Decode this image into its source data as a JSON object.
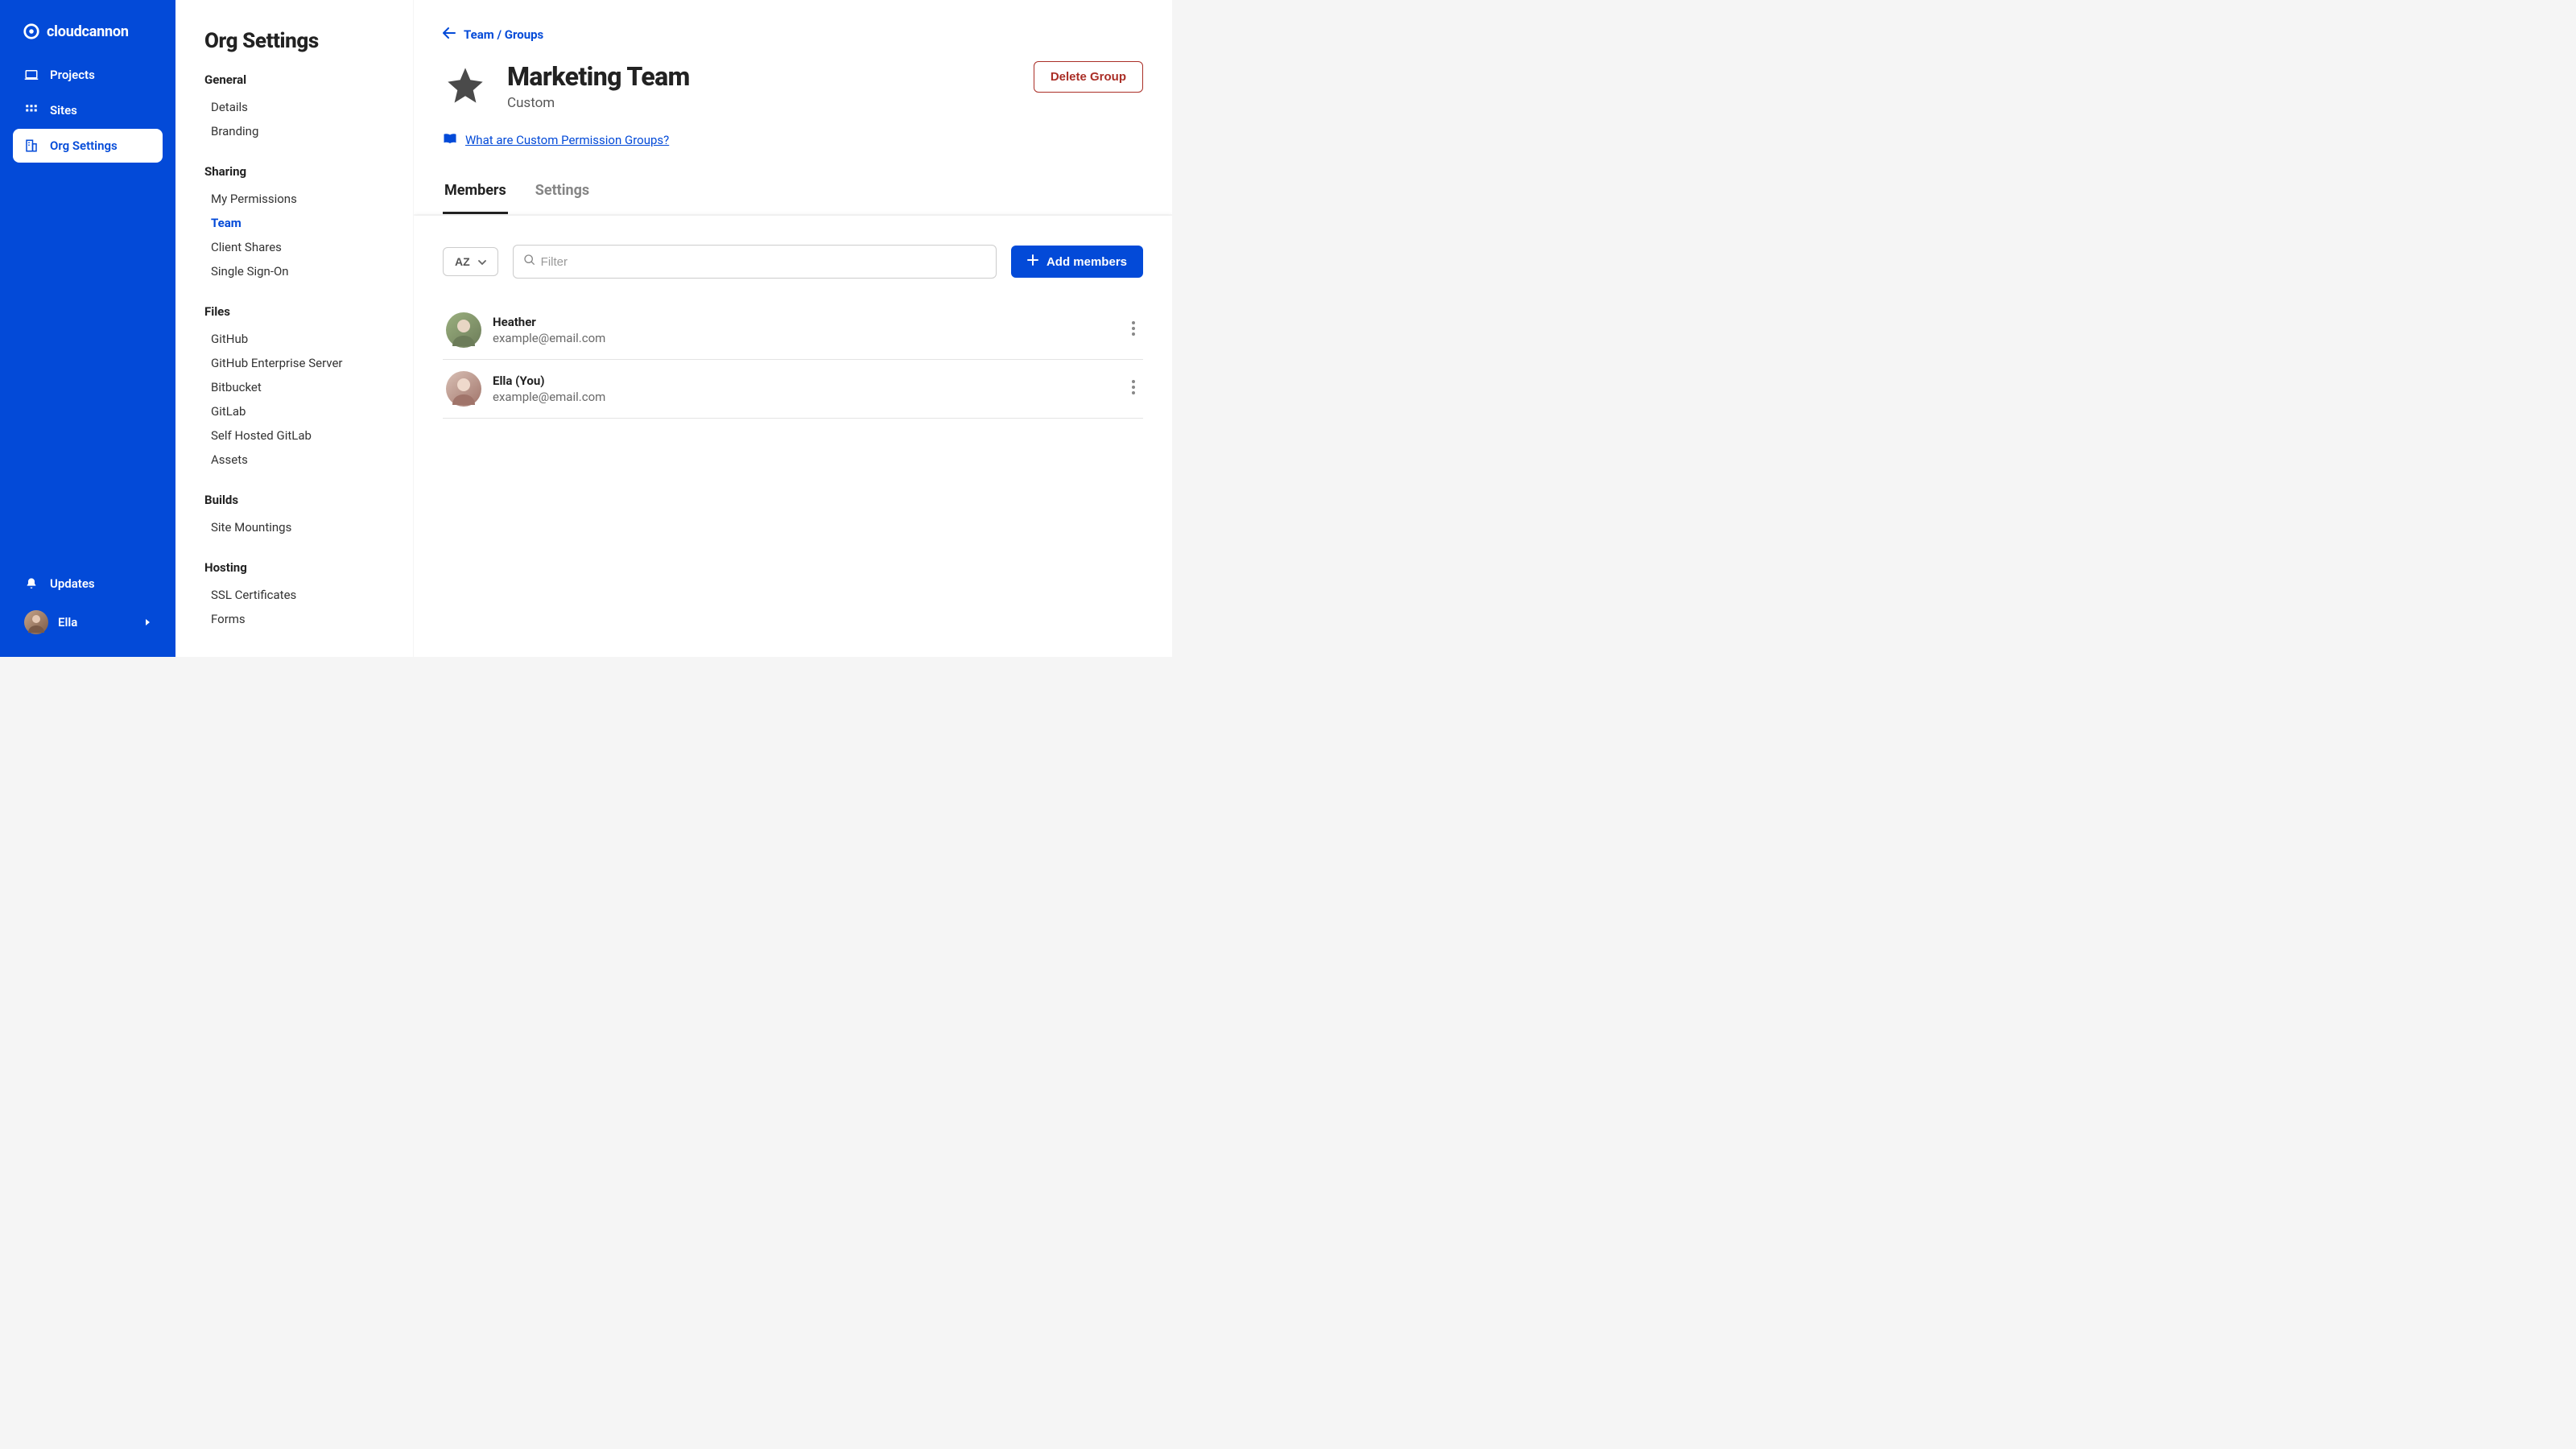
{
  "brand": {
    "name": "cloudcannon"
  },
  "nav": {
    "items": [
      {
        "label": "Projects"
      },
      {
        "label": "Sites"
      },
      {
        "label": "Org Settings"
      }
    ],
    "updates": "Updates",
    "user": "Ella"
  },
  "settings": {
    "title": "Org Settings",
    "groups": [
      {
        "heading": "General",
        "items": [
          "Details",
          "Branding"
        ]
      },
      {
        "heading": "Sharing",
        "items": [
          "My Permissions",
          "Team",
          "Client Shares",
          "Single Sign-On"
        ]
      },
      {
        "heading": "Files",
        "items": [
          "GitHub",
          "GitHub Enterprise Server",
          "Bitbucket",
          "GitLab",
          "Self Hosted GitLab",
          "Assets"
        ]
      },
      {
        "heading": "Builds",
        "items": [
          "Site Mountings"
        ]
      },
      {
        "heading": "Hosting",
        "items": [
          "SSL Certificates",
          "Forms"
        ]
      }
    ]
  },
  "breadcrumb": "Team / Groups",
  "page": {
    "title": "Marketing Team",
    "subtitle": "Custom",
    "delete": "Delete Group",
    "help": "What are Custom Permission Groups?"
  },
  "tabs": [
    "Members",
    "Settings"
  ],
  "toolbar": {
    "sort": "AZ",
    "filter_placeholder": "Filter",
    "add": "Add members"
  },
  "members": [
    {
      "name": "Heather",
      "email": "example@email.com"
    },
    {
      "name": "Ella (You)",
      "email": "example@email.com"
    }
  ]
}
